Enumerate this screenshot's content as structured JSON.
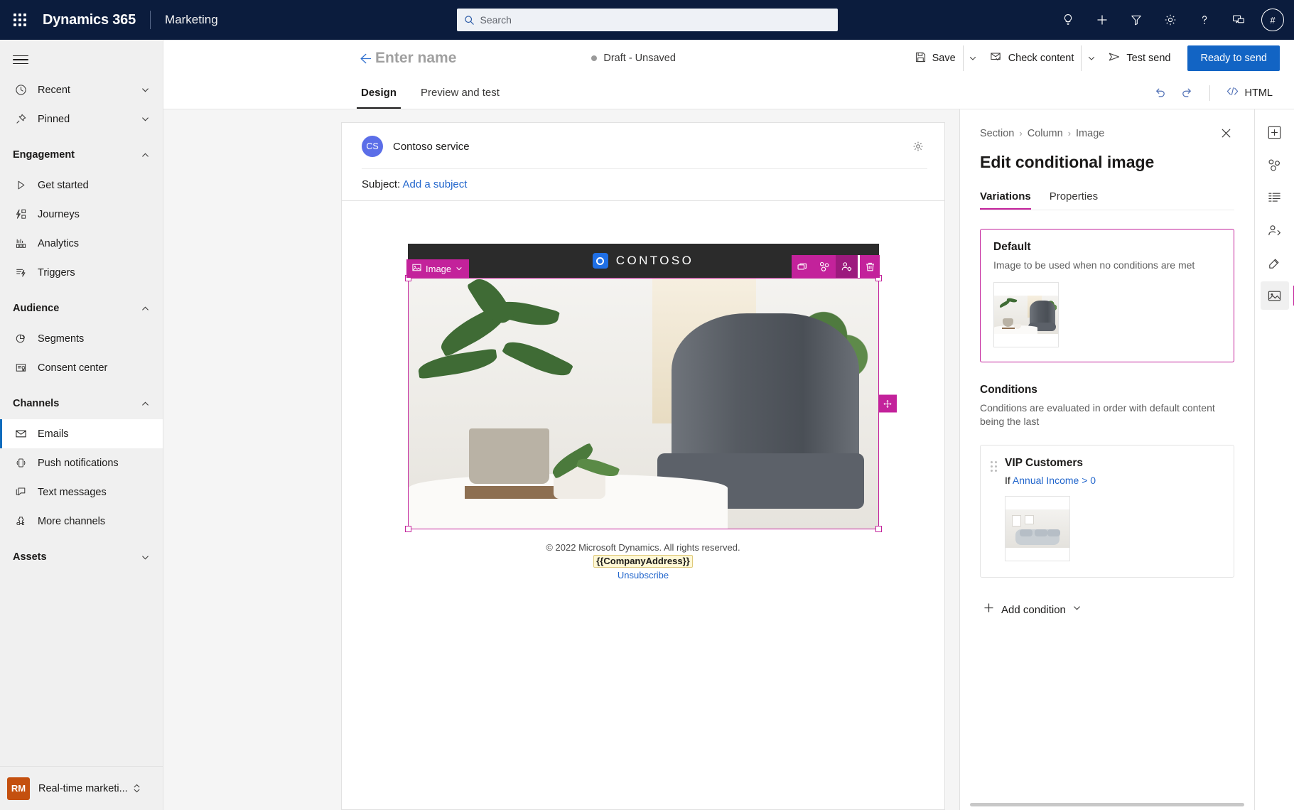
{
  "topnav": {
    "waffle_label": "app-launcher",
    "brand": "Dynamics 365",
    "app_name": "Marketing",
    "search_placeholder": "Search",
    "icons": [
      {
        "name": "lightbulb-icon",
        "label": "Insights"
      },
      {
        "name": "plus-icon",
        "label": "Quick create"
      },
      {
        "name": "filter-icon",
        "label": "Filter"
      },
      {
        "name": "gear-icon",
        "label": "Settings"
      },
      {
        "name": "help-icon",
        "label": "Help"
      },
      {
        "name": "feedback-icon",
        "label": "Feedback"
      }
    ],
    "avatar_initials": "#"
  },
  "sidebar": {
    "quick": [
      {
        "label": "Recent",
        "icon": "clock-icon",
        "chevron": "down"
      },
      {
        "label": "Pinned",
        "icon": "pin-icon",
        "chevron": "down"
      }
    ],
    "groups": [
      {
        "label": "Engagement",
        "chevron": "up",
        "items": [
          {
            "label": "Get started",
            "icon": "play-icon"
          },
          {
            "label": "Journeys",
            "icon": "journeys-icon"
          },
          {
            "label": "Analytics",
            "icon": "analytics-icon"
          },
          {
            "label": "Triggers",
            "icon": "triggers-icon"
          }
        ]
      },
      {
        "label": "Audience",
        "chevron": "up",
        "items": [
          {
            "label": "Segments",
            "icon": "segments-icon"
          },
          {
            "label": "Consent center",
            "icon": "consent-icon"
          }
        ]
      },
      {
        "label": "Channels",
        "chevron": "up",
        "items": [
          {
            "label": "Emails",
            "icon": "mail-icon",
            "selected": true
          },
          {
            "label": "Push notifications",
            "icon": "push-icon"
          },
          {
            "label": "Text messages",
            "icon": "sms-icon"
          },
          {
            "label": "More channels",
            "icon": "more-channels-icon"
          }
        ]
      },
      {
        "label": "Assets",
        "chevron": "down",
        "items": []
      }
    ],
    "area_switcher": {
      "badge": "RM",
      "label": "Real-time marketi...",
      "icon": "up-down-chevron-icon"
    }
  },
  "command_bar": {
    "back_icon": "back-arrow-icon",
    "record_title": "Enter name",
    "status": "Draft - Unsaved",
    "save_label": "Save",
    "save_icon": "save-icon",
    "check_content_label": "Check content",
    "check_content_icon": "check-content-icon",
    "test_send_label": "Test send",
    "test_send_icon": "send-icon",
    "ready_label": "Ready to send",
    "primary_color": "#1264c4"
  },
  "tabs": {
    "items": [
      {
        "label": "Design",
        "active": true
      },
      {
        "label": "Preview and test",
        "active": false
      }
    ],
    "undo_icon": "undo-icon",
    "redo_icon": "redo-icon",
    "html_label": "HTML",
    "html_icon": "code-icon"
  },
  "email": {
    "sender_initials": "CS",
    "sender_name": "Contoso service",
    "settings_icon": "gear-icon",
    "subject_label": "Subject:",
    "subject_link": "Add a subject",
    "header_brand": "CONTOSO",
    "selected_block": {
      "tag_label": "Image",
      "tag_icon": "image-icon",
      "tag_chevron": "chevron-down-icon",
      "accent_color": "#c3229b",
      "tools": [
        {
          "name": "duplicate-icon",
          "label": "Duplicate"
        },
        {
          "name": "save-as-fragment-icon",
          "label": "Save as fragment"
        },
        {
          "name": "conditional-content-icon",
          "label": "Conditional content",
          "active": true
        },
        {
          "name": "delete-icon",
          "label": "Delete"
        }
      ],
      "drag_icon": "move-handle-icon"
    },
    "footer": {
      "copyright": "© 2022 Microsoft Dynamics. All rights reserved.",
      "address_token": "{{CompanyAddress}}",
      "unsubscribe": "Unsubscribe"
    }
  },
  "panel": {
    "breadcrumb": [
      "Section",
      "Column",
      "Image"
    ],
    "breadcrumb_sep": "›",
    "close_icon": "close-icon",
    "title": "Edit conditional image",
    "tabs": [
      {
        "label": "Variations",
        "active": true
      },
      {
        "label": "Properties",
        "active": false
      }
    ],
    "default_card": {
      "title": "Default",
      "description": "Image to be used when no conditions are met",
      "thumbnail_name": "default-image-thumbnail"
    },
    "conditions": {
      "heading": "Conditions",
      "description": "Conditions are evaluated in order with default content being the last",
      "items": [
        {
          "name": "VIP Customers",
          "rule_prefix": "If",
          "rule_attribute": "Annual Income",
          "rule_operator": ">",
          "rule_value": "0",
          "thumbnail_name": "vip-image-thumbnail"
        }
      ],
      "add_label": "Add condition",
      "add_icon": "plus-icon",
      "add_chevron": "chevron-down-icon"
    }
  },
  "rail": {
    "items": [
      {
        "name": "add-element-icon",
        "label": "Elements"
      },
      {
        "name": "fragments-icon",
        "label": "Fragments"
      },
      {
        "name": "layouts-icon",
        "label": "Layouts"
      },
      {
        "name": "personalization-icon",
        "label": "Personalization"
      },
      {
        "name": "brand-icon",
        "label": "Brand"
      },
      {
        "name": "images-icon",
        "label": "Images",
        "active": true
      }
    ]
  }
}
